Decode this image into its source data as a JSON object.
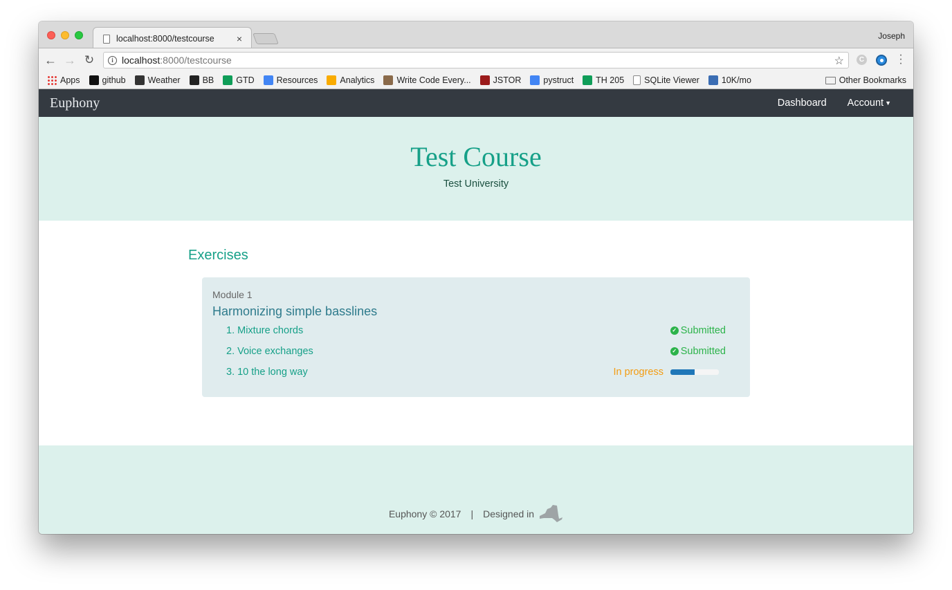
{
  "browser": {
    "tab_title": "localhost:8000/testcourse",
    "tab_close": "×",
    "user": "Joseph",
    "url_host": "localhost",
    "url_path": ":8000/testcourse",
    "bookmarks": [
      {
        "label": "Apps",
        "icon": "apps-grid-icon",
        "color": "#4285f4"
      },
      {
        "label": "github",
        "icon": "github-icon",
        "color": "#111111"
      },
      {
        "label": "Weather",
        "icon": "weather-icon",
        "color": "#333333"
      },
      {
        "label": "BB",
        "icon": "blackboard-icon",
        "color": "#222222"
      },
      {
        "label": "GTD",
        "icon": "sheets-icon",
        "color": "#0f9d58"
      },
      {
        "label": "Resources",
        "icon": "docs-icon",
        "color": "#4285f4"
      },
      {
        "label": "Analytics",
        "icon": "analytics-icon",
        "color": "#f9ab00"
      },
      {
        "label": "Write Code Every...",
        "icon": "avatar-icon",
        "color": "#8a6a4a"
      },
      {
        "label": "JSTOR",
        "icon": "jstor-icon",
        "color": "#9b1b1b"
      },
      {
        "label": "pystruct",
        "icon": "docs-icon",
        "color": "#4285f4"
      },
      {
        "label": "TH 205",
        "icon": "drive-icon",
        "color": "#0f9d58"
      },
      {
        "label": "SQLite Viewer",
        "icon": "file-icon",
        "color": "#888888"
      },
      {
        "label": "10K/mo",
        "icon": "tracker-icon",
        "color": "#3b6db3"
      }
    ],
    "other_bookmarks": "Other Bookmarks"
  },
  "navbar": {
    "brand": "Euphony",
    "links": [
      "Dashboard",
      "Account"
    ]
  },
  "hero": {
    "title": "Test Course",
    "subtitle": "Test University"
  },
  "main": {
    "section_title": "Exercises",
    "modules": [
      {
        "label": "Module 1",
        "title": "Harmonizing simple basslines",
        "exercises": [
          {
            "name": "1. Mixture chords",
            "status": "Submitted"
          },
          {
            "name": "2. Voice exchanges",
            "status": "Submitted"
          },
          {
            "name": "3. 10 the long way",
            "status": "In progress",
            "progress": 0.5
          }
        ]
      }
    ]
  },
  "footer": {
    "copyright": "Euphony © 2017",
    "separator": "|",
    "designed": "Designed in"
  },
  "colors": {
    "accent": "#16a088",
    "navbar": "#343a41",
    "hero_bg": "#dcf1ec",
    "submitted": "#2cb34a",
    "in_progress": "#f39c12",
    "progress_bar": "#1f77b8"
  }
}
